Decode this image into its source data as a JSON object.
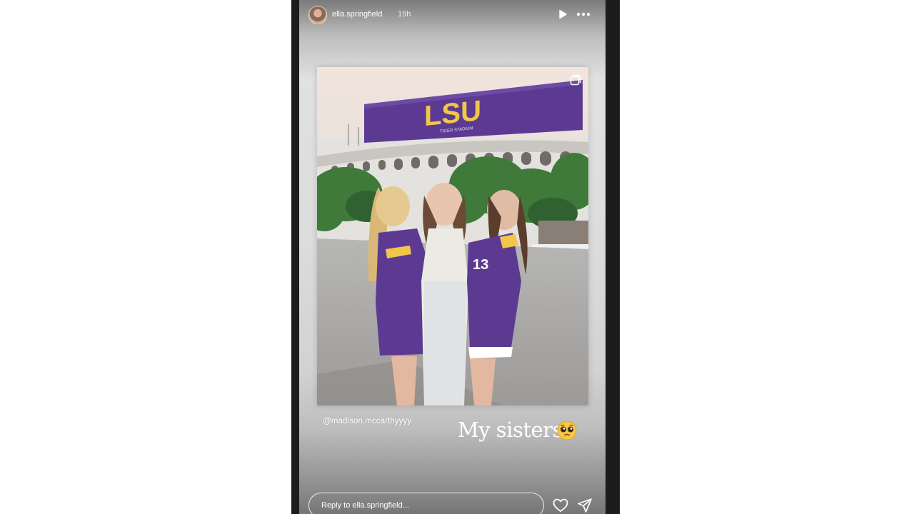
{
  "story": {
    "username": "ella.springfield",
    "timestamp": "19h",
    "icons": {
      "avatar": "profile-avatar",
      "play": "play-icon",
      "more": "more-horizontal-icon",
      "carousel": "carousel-icon",
      "heart": "heart-icon",
      "share": "paper-plane-icon",
      "emoji": "pleading-face-emoji"
    }
  },
  "post": {
    "sign_text": "LSU",
    "sign_subtext": "TIGER STADIUM",
    "jersey_number": "13",
    "mention": "@madison.mccarthyyyy",
    "caption": "My sisters"
  },
  "reply": {
    "placeholder": "Reply to ella.springfield..."
  },
  "colors": {
    "lsu_purple": "#5c3a92",
    "lsu_gold": "#f2c64a"
  }
}
